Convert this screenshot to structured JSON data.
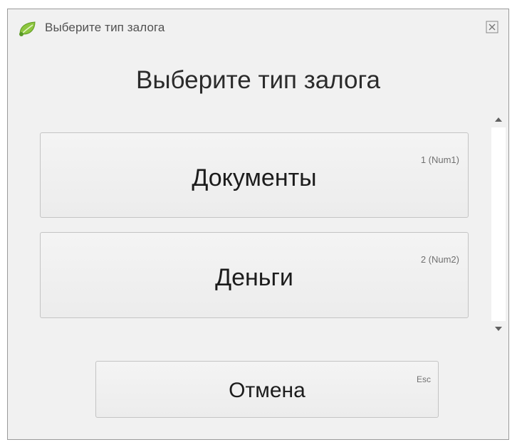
{
  "window": {
    "title": "Выберите тип залога",
    "icon": "leaf-icon",
    "close_icon": "close-icon"
  },
  "dialog": {
    "heading": "Выберите тип залога",
    "options": [
      {
        "label": "Документы",
        "hotkey": "1 (Num1)"
      },
      {
        "label": "Деньги",
        "hotkey": "2 (Num2)"
      }
    ],
    "cancel": {
      "label": "Отмена",
      "hotkey": "Esc"
    }
  },
  "scrollbar": {
    "up_icon": "scroll-up-arrow-icon",
    "down_icon": "scroll-down-arrow-icon"
  },
  "colors": {
    "window_background": "#f1f1f1",
    "button_background": "#f0f0f0",
    "button_border": "#c4c4c4",
    "icon_green": "#7cc242"
  }
}
